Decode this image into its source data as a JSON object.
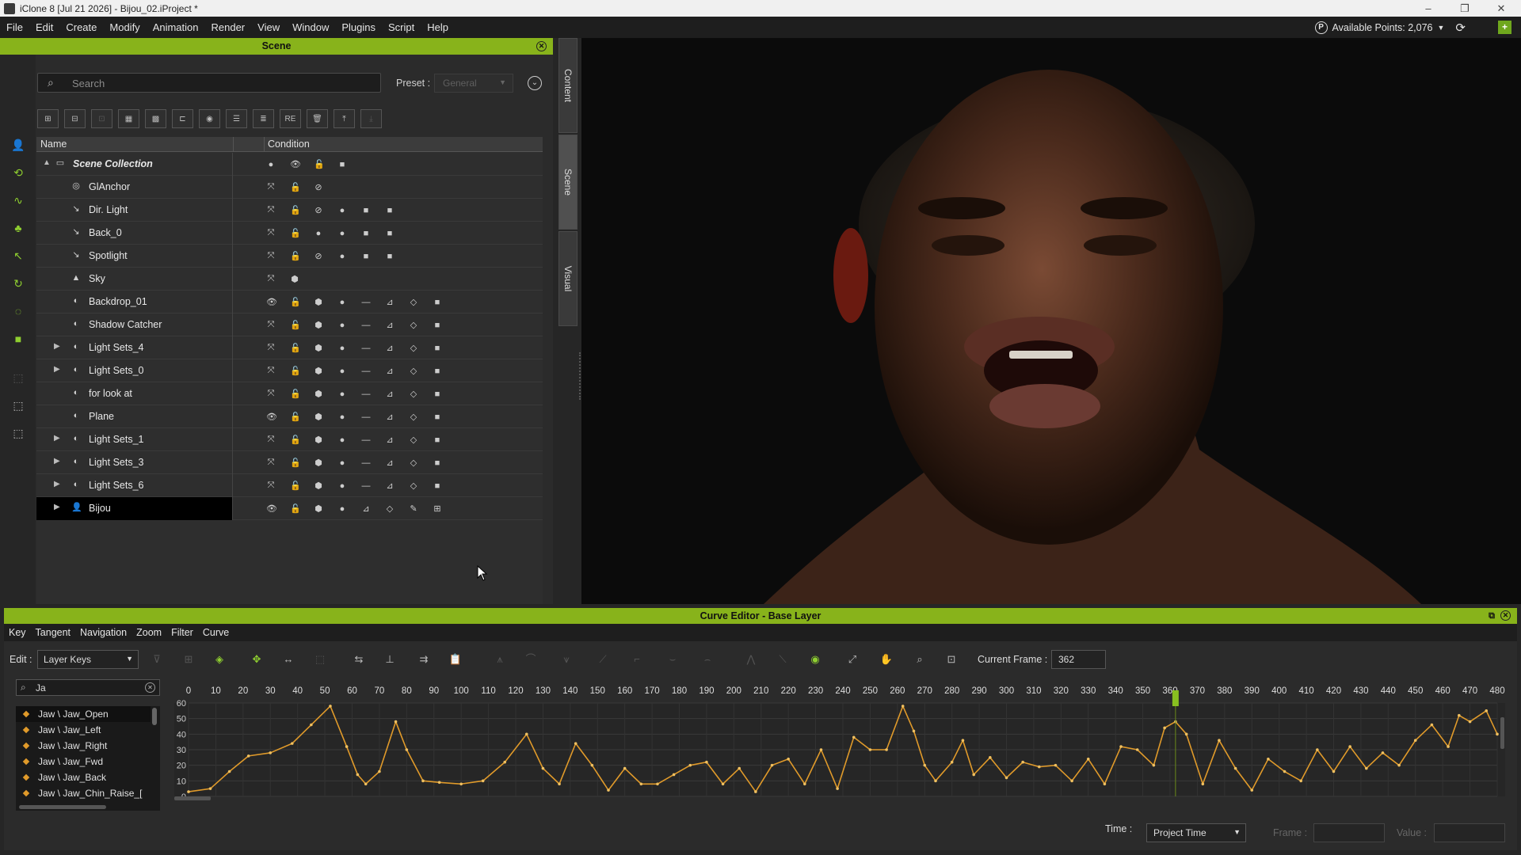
{
  "window": {
    "title": "iClone 8 [Jul 21 2026] - Bijou_02.iProject *",
    "minimize": "–",
    "maximize": "❐",
    "close": "✕"
  },
  "menu": [
    "File",
    "Edit",
    "Create",
    "Modify",
    "Animation",
    "Render",
    "View",
    "Window",
    "Plugins",
    "Script",
    "Help"
  ],
  "points": {
    "label": "Available Points: 2,076",
    "icon": "P"
  },
  "scene_panel": {
    "title": "Scene",
    "search_placeholder": "Search",
    "preset_label": "Preset :",
    "preset_value": "General",
    "col_name": "Name",
    "col_condition": "Condition",
    "rows": [
      {
        "label": "Scene Collection",
        "exp": "▲",
        "icon": "▭",
        "cond": "● 👁 🔓 ■"
      },
      {
        "label": "GlAnchor",
        "exp": "",
        "icon": "◎",
        "cond": "⤧ 🔓 ⊘"
      },
      {
        "label": "Dir. Light",
        "exp": "",
        "icon": "↘",
        "cond": "⤧ 🔓 ⊘ ● ■ ■"
      },
      {
        "label": "Back_0",
        "exp": "",
        "icon": "↘",
        "cond": "⤧ 🔓 ● ● ■ ■"
      },
      {
        "label": "Spotlight",
        "exp": "",
        "icon": "↘",
        "cond": "⤧ 🔓 ⊘ ● ■ ■"
      },
      {
        "label": "Sky",
        "exp": "",
        "icon": "▲",
        "cond": "⤧ ⬢"
      },
      {
        "label": "Backdrop_01",
        "exp": "",
        "icon": "◐",
        "cond": "👁 🔓 ⬢ ● — ⊿ ◇ ■"
      },
      {
        "label": "Shadow Catcher",
        "exp": "",
        "icon": "◐",
        "cond": "⤧ 🔓 ⬢ ● — ⊿ ◇ ■"
      },
      {
        "label": "Light Sets_4",
        "exp": "▶",
        "icon": "◐",
        "cond": "⤧ 🔓 ⬢ ● — ⊿ ◇ ■"
      },
      {
        "label": "Light Sets_0",
        "exp": "▶",
        "icon": "◐",
        "cond": "⤧ 🔓 ⬢ ● — ⊿ ◇ ■"
      },
      {
        "label": "for look at",
        "exp": "",
        "icon": "◐",
        "cond": "⤧ 🔓 ⬢ ● — ⊿ ◇ ■"
      },
      {
        "label": "Plane",
        "exp": "",
        "icon": "◐",
        "cond": "👁 🔓 ⬢ ● — ⊿ ◇ ■"
      },
      {
        "label": "Light Sets_1",
        "exp": "▶",
        "icon": "◐",
        "cond": "⤧ 🔓 ⬢ ● — ⊿ ◇ ■"
      },
      {
        "label": "Light Sets_3",
        "exp": "▶",
        "icon": "◐",
        "cond": "⤧ 🔓 ⬢ ● — ⊿ ◇ ■"
      },
      {
        "label": "Light Sets_6",
        "exp": "▶",
        "icon": "◐",
        "cond": "⤧ 🔓 ⬢ ● — ⊿ ◇ ■"
      },
      {
        "label": "Bijou",
        "exp": "▶",
        "icon": "👤",
        "cond": "👁 🔓 ⬢ ● ⊿ ◇ ✎ ⊞"
      }
    ]
  },
  "side_tabs": [
    "Content",
    "Scene",
    "Visual"
  ],
  "curve_editor": {
    "title": "Curve Editor - Base Layer",
    "menu": [
      "Key",
      "Tangent",
      "Navigation",
      "Zoom",
      "Filter",
      "Curve"
    ],
    "edit_label": "Edit :",
    "edit_value": "Layer Keys",
    "current_frame_label": "Current Frame :",
    "current_frame_value": "362",
    "search_value": "Ja",
    "channels": [
      "Jaw \\ Jaw_Open",
      "Jaw \\ Jaw_Left",
      "Jaw \\ Jaw_Right",
      "Jaw \\ Jaw_Fwd",
      "Jaw \\ Jaw_Back",
      "Jaw \\ Jaw_Chin_Raise_["
    ],
    "time_label": "Time :",
    "time_value": "Project Time",
    "frame_label": "Frame :",
    "value_label": "Value :"
  },
  "chart_data": {
    "type": "line",
    "title": "",
    "xlabel": "",
    "ylabel": "",
    "xlim": [
      0,
      480
    ],
    "ylim": [
      0,
      60
    ],
    "x_ticks": [
      0,
      10,
      20,
      30,
      40,
      50,
      60,
      70,
      80,
      90,
      100,
      110,
      120,
      130,
      140,
      150,
      160,
      170,
      180,
      190,
      200,
      210,
      220,
      230,
      240,
      250,
      260,
      270,
      280,
      290,
      300,
      310,
      320,
      330,
      340,
      350,
      360,
      370,
      380,
      390,
      400,
      410,
      420,
      430,
      440,
      450,
      460,
      470,
      480
    ],
    "y_ticks": [
      0,
      10,
      20,
      30,
      40,
      50,
      60
    ],
    "current_frame": 362,
    "series": [
      {
        "name": "Jaw \\ Jaw_Open",
        "color": "#e09a2a",
        "x": [
          0,
          8,
          15,
          22,
          30,
          38,
          45,
          52,
          58,
          62,
          65,
          70,
          76,
          80,
          86,
          92,
          100,
          108,
          116,
          124,
          130,
          136,
          142,
          148,
          154,
          160,
          166,
          172,
          178,
          184,
          190,
          196,
          202,
          208,
          214,
          220,
          226,
          232,
          238,
          244,
          250,
          256,
          262,
          266,
          270,
          274,
          280,
          284,
          288,
          294,
          300,
          306,
          312,
          318,
          324,
          330,
          336,
          342,
          348,
          354,
          358,
          362,
          366,
          372,
          378,
          384,
          390,
          396,
          402,
          408,
          414,
          420,
          426,
          432,
          438,
          444,
          450,
          456,
          462,
          466,
          470,
          476,
          480
        ],
        "y": [
          3,
          5,
          16,
          26,
          28,
          34,
          46,
          58,
          32,
          14,
          8,
          16,
          48,
          30,
          10,
          9,
          8,
          10,
          22,
          40,
          18,
          8,
          34,
          20,
          4,
          18,
          8,
          8,
          14,
          20,
          22,
          8,
          18,
          3,
          20,
          24,
          8,
          30,
          5,
          38,
          30,
          30,
          58,
          42,
          20,
          10,
          22,
          36,
          14,
          25,
          12,
          22,
          19,
          20,
          10,
          24,
          8,
          32,
          30,
          20,
          44,
          48,
          40,
          8,
          36,
          18,
          4,
          24,
          16,
          10,
          30,
          16,
          32,
          18,
          28,
          20,
          36,
          46,
          32,
          52,
          48,
          55,
          40
        ]
      }
    ]
  },
  "colors": {
    "accent": "#88b31b",
    "curve": "#e09a2a",
    "bg": "#262626"
  }
}
